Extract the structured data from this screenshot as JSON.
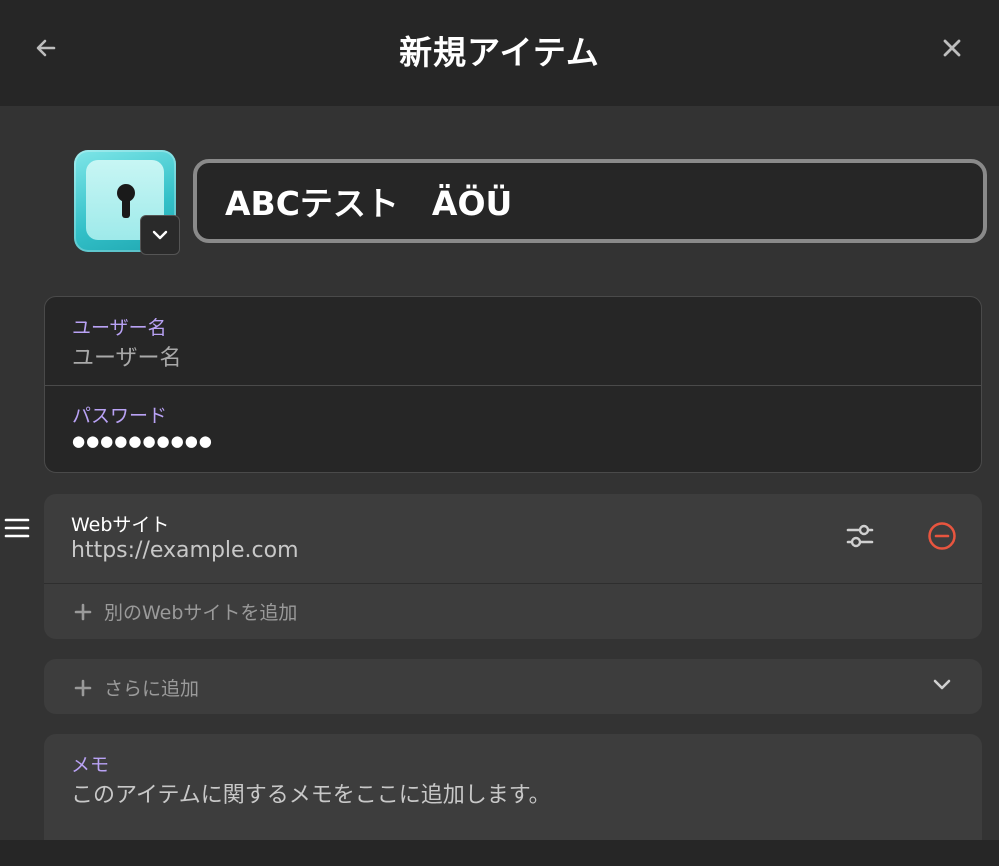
{
  "header": {
    "title": "新規アイテム"
  },
  "item": {
    "title_value": "ABCテスト　ÄÖÜ"
  },
  "credentials": {
    "username": {
      "label": "ユーザー名",
      "placeholder": "ユーザー名"
    },
    "password": {
      "label": "パスワード",
      "value": "●●●●●●●●●●"
    }
  },
  "website": {
    "label": "Webサイト",
    "value": "https://example.com",
    "add_label": "別のWebサイトを追加"
  },
  "more": {
    "label": "さらに追加"
  },
  "memo": {
    "label": "メモ",
    "placeholder": "このアイテムに関するメモをここに追加します。"
  },
  "colors": {
    "accent_label": "#b9a2f5",
    "remove_icon": "#e8553f",
    "icon_teal": "#33c0c8"
  },
  "icons": [
    "arrow-left-icon",
    "close-icon",
    "keyhole-icon",
    "chevron-down-icon",
    "drag-handle-icon",
    "sliders-icon",
    "remove-circle-icon",
    "plus-icon"
  ]
}
